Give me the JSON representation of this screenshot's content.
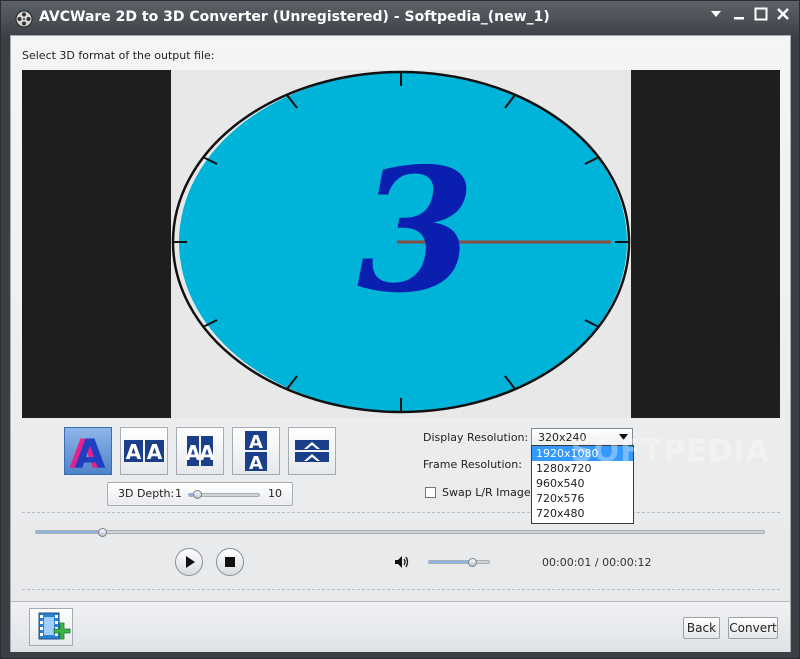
{
  "window": {
    "title": "AVCWare 2D to 3D Converter (Unregistered) - Softpedia_(new_1)"
  },
  "main": {
    "instruction": "Select 3D format of the output file:",
    "preview_number": "3"
  },
  "depth": {
    "label": "3D Depth:",
    "min": "1",
    "max": "10",
    "value": 2
  },
  "display_resolution": {
    "label": "Display Resolution:",
    "selected": "320x240",
    "options": [
      "1920x1080",
      "1280x720",
      "960x540",
      "720x576",
      "720x480"
    ],
    "highlighted": "1920x1080"
  },
  "frame_resolution": {
    "label": "Frame Resolution:"
  },
  "swap": {
    "label": "Swap L/R Image"
  },
  "playback": {
    "time": "00:00:01 / 00:00:12",
    "progress": 0.09,
    "volume": 0.7
  },
  "footer": {
    "back_label": "Back",
    "convert_label": "Convert"
  },
  "watermark": "SOFTPEDIA",
  "colors": {
    "clock_face": "#00b3d8",
    "numeral": "#0a1fb0",
    "selected_format": "#4f83c9",
    "highlight": "#3399ff"
  }
}
